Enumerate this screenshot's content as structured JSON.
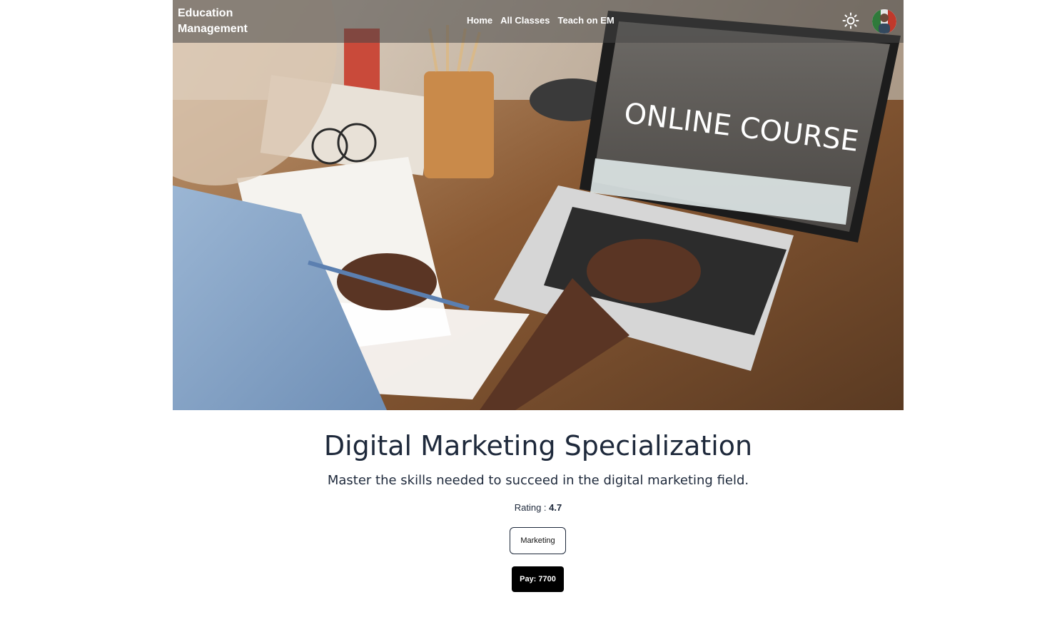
{
  "navbar": {
    "brand_line1": "Education",
    "brand_line2": "Management",
    "links": [
      "Home",
      "All Classes",
      "Teach on EM"
    ],
    "theme_icon": "sun-icon",
    "avatar_icon": "user-avatar"
  },
  "hero": {
    "image_alt": "Person typing on a laptop showing an online course website",
    "screen_text": "ONLINE COURSE"
  },
  "course": {
    "title": "Digital Marketing Specialization",
    "description": "Master the skills needed to succeed in the digital marketing field.",
    "rating_label": "Rating :",
    "rating_value": "4.7",
    "category": "Marketing",
    "pay_label": "Pay: 7700"
  },
  "colors": {
    "text": "#1e293b",
    "nav_overlay": "rgba(70,70,70,0.55)",
    "pay_button": "#000000"
  }
}
